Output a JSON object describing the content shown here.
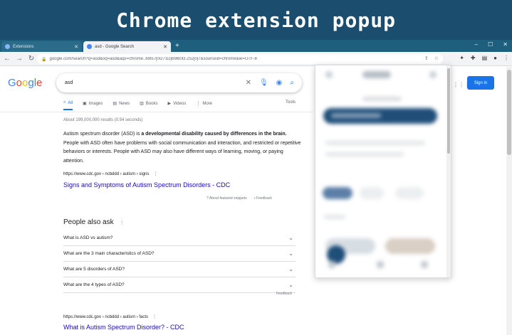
{
  "banner": {
    "title": "Chrome extension popup"
  },
  "tabs": [
    {
      "label": "Extensions",
      "active": false
    },
    {
      "label": "asd - Google Search",
      "active": true
    }
  ],
  "toolbar": {
    "url": "google.com/search?q=asd&oq=asd&aqs=chrome..69i57j0i271l2j69i60l3.252j0j7&sourceid=chrome&ie=UTF-8"
  },
  "google": {
    "logo": [
      "G",
      "o",
      "o",
      "g",
      "l",
      "e"
    ],
    "logo_colors": [
      "#4285f4",
      "#ea4335",
      "#fbbc05",
      "#4285f4",
      "#34a853",
      "#ea4335"
    ],
    "query": "asd",
    "tabs": [
      {
        "label": "All",
        "icon": "search-icon"
      },
      {
        "label": "Images",
        "icon": "image-icon"
      },
      {
        "label": "News",
        "icon": "news-icon"
      },
      {
        "label": "Books",
        "icon": "book-icon"
      },
      {
        "label": "Videos",
        "icon": "video-icon"
      },
      {
        "label": "More",
        "icon": "more-icon"
      }
    ],
    "tools_label": "Tools",
    "result_stats": "About 199,000,000 results (0.54 seconds)",
    "snippet_lead": "Autism spectrum disorder (ASD) is ",
    "snippet_bold": "a developmental disability caused by differences in the brain.",
    "snippet_rest": " People with ASD often have problems with social communication and interaction, and restricted or repetitive behaviors or interests. People with ASD may also have different ways of learning, moving, or paying attention.",
    "cite_1": "https://www.cdc.gov › ncbddd › autism › signs",
    "result_1_title": "Signs and Symptoms of Autism Spectrum Disorders - CDC",
    "about_featured": "About featured snippets",
    "feedback_1": "Feedback",
    "paa_title": "People also ask",
    "paa": [
      "What is ASD vs autism?",
      "What are the 3 main characteristics of ASD?",
      "What are 5 disorders of ASD?",
      "What are the 4 types of ASD?"
    ],
    "feedback_2": "Feedback",
    "cite_2": "https://www.cdc.gov › ncbddd › autism › facts",
    "result_2_title": "What is Autism Spectrum Disorder? - CDC",
    "signin": "Sign in"
  },
  "colors": {
    "banner": "#1b4d6e",
    "tabstrip": "#1f5f7e",
    "link": "#1a0dab",
    "accent": "#1a73e8",
    "popup_primary": "#1f4e79"
  }
}
